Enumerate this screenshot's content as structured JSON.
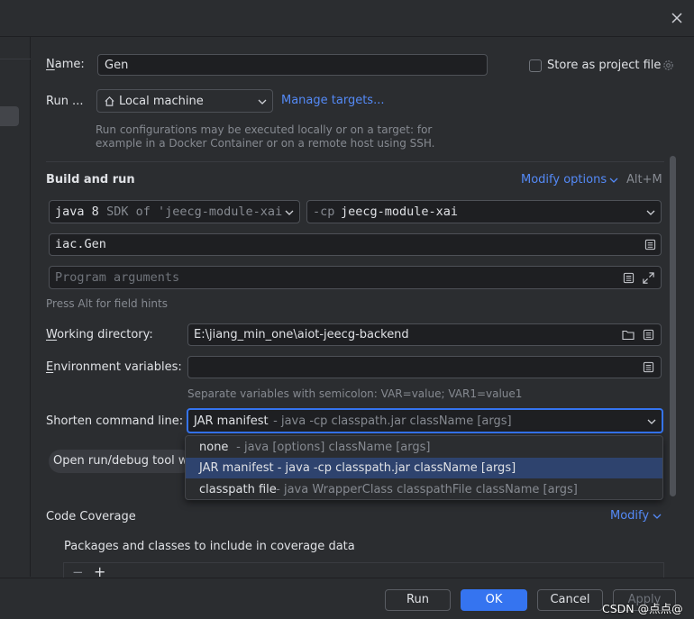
{
  "dialog": {
    "name_label": "Name:",
    "name_value": "Gen",
    "store_project_label": "Store as project file",
    "run_on_label": "Run ...",
    "run_target": "Local machine",
    "manage_targets": "Manage targets...",
    "run_hint_line1": "Run configurations may be executed locally or on a target: for",
    "run_hint_line2": "example in a Docker Container or on a remote host using SSH."
  },
  "build_run": {
    "title": "Build and run",
    "modify_options": "Modify options",
    "modify_shortcut": "Alt+M",
    "jdk_name": "java 8",
    "jdk_detail": " SDK of 'jeecg-module-xai",
    "cp_prefix": "-cp",
    "cp_module": "jeecg-module-xai",
    "main_class": "iac.Gen",
    "program_args_placeholder": "Program arguments",
    "field_hint": "Press Alt for field hints"
  },
  "working_dir": {
    "label": "Working directory:",
    "value": "E:\\jiang_min_one\\aiot-jeecg-backend"
  },
  "env_vars": {
    "label": "Environment variables:",
    "value": "",
    "hint": "Separate variables with semicolon: VAR=value; VAR1=value1"
  },
  "shorten": {
    "label": "Shorten command line:",
    "selected_name": "JAR manifest",
    "selected_detail": " - java -cp classpath.jar className [args]",
    "options": [
      {
        "name": "none",
        "detail": " - java [options] className [args]"
      },
      {
        "name": "JAR manifest - java -cp classpath.jar className [args]",
        "detail": ""
      },
      {
        "name": "classpath file",
        "detail": " - java WrapperClass classpathFile className [args]"
      }
    ]
  },
  "open_tool_window": "Open run/debug tool w",
  "code_coverage": {
    "title": "Code Coverage",
    "modify": "Modify",
    "packages_label": "Packages and classes to include in coverage data",
    "remove": "−",
    "add": "+"
  },
  "footer": {
    "run": "Run",
    "ok": "OK",
    "cancel": "Cancel",
    "apply": "Apply",
    "watermark": "CSDN @点点@"
  },
  "colors": {
    "background": "#2b2d30",
    "field": "#1e1f22",
    "accent": "#3574f0",
    "link": "#548af7",
    "selection": "#2e436e"
  }
}
